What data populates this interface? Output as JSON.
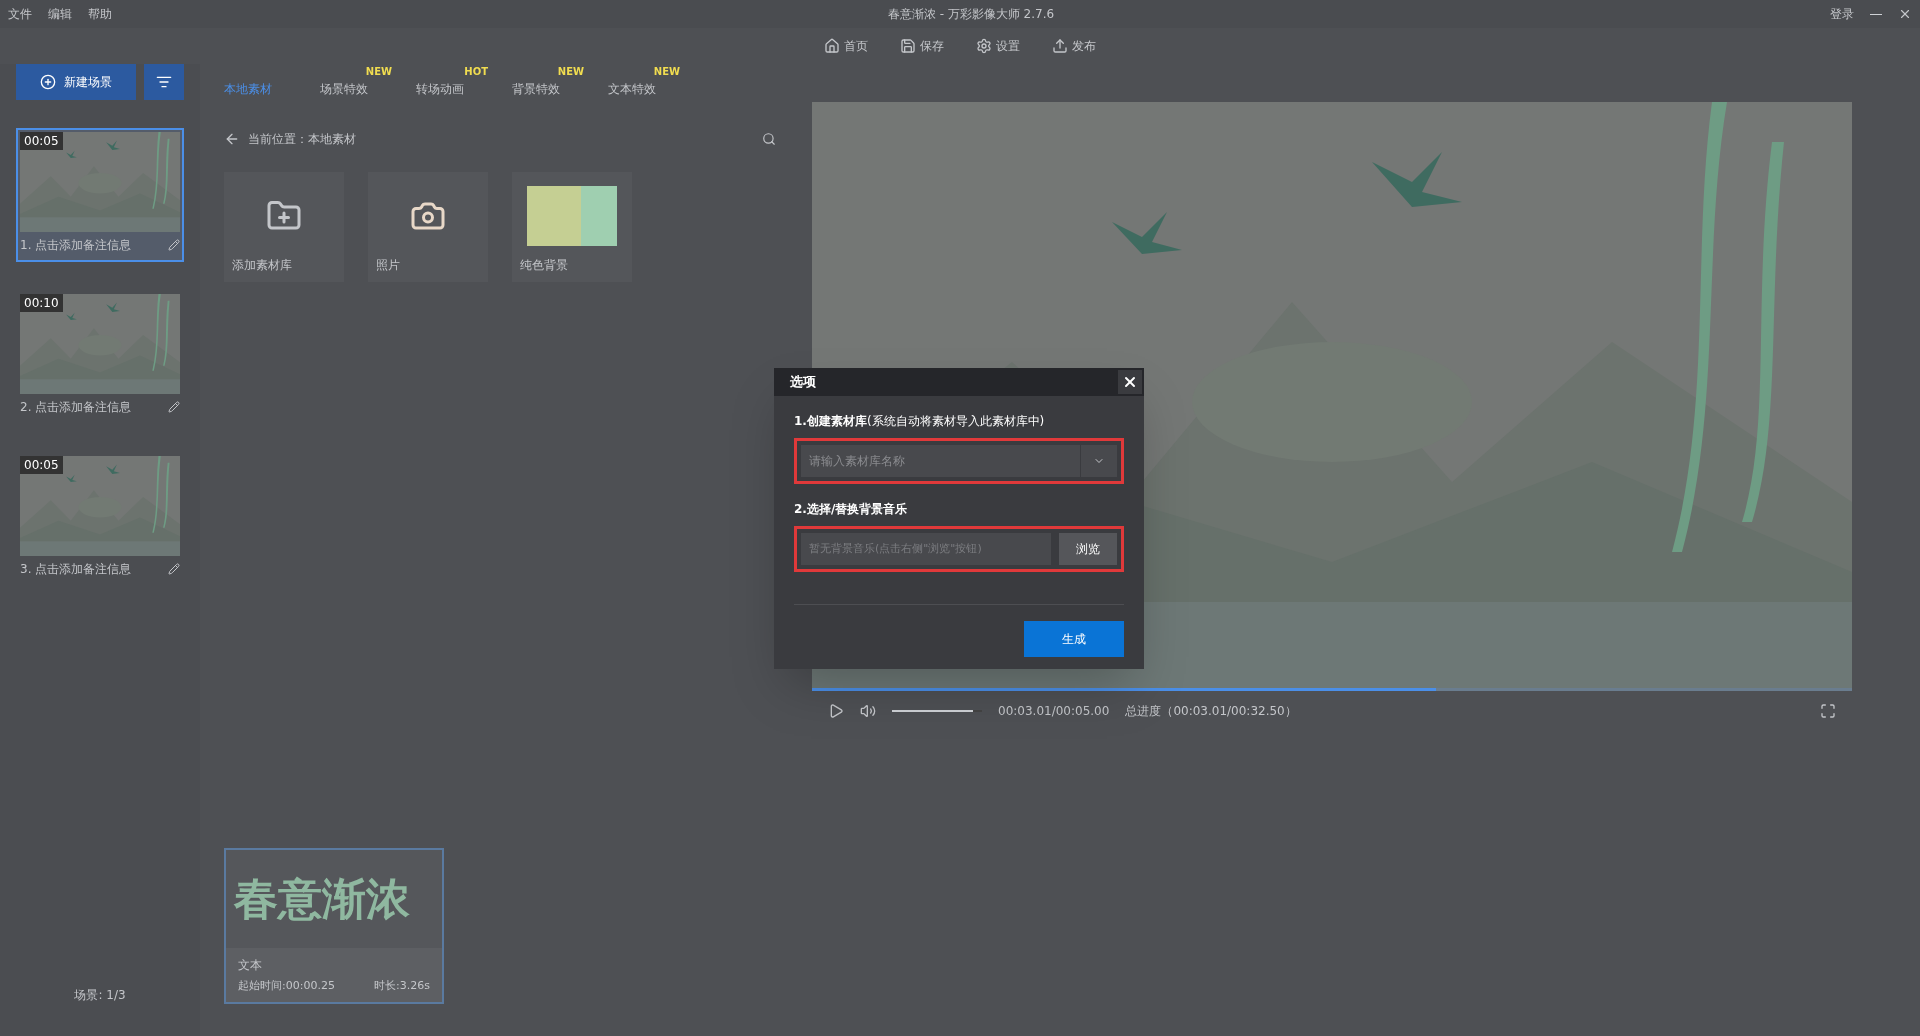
{
  "window": {
    "title": "春意渐浓 - 万彩影像大师 2.7.6",
    "menu": [
      "文件",
      "编辑",
      "帮助"
    ],
    "login": "登录"
  },
  "toolbar": [
    "首页",
    "保存",
    "设置",
    "发布"
  ],
  "left_panel": {
    "new_scene": "新建场景",
    "scenes": [
      {
        "time": "00:05",
        "caption": "1. 点击添加备注信息",
        "selected": true
      },
      {
        "time": "00:10",
        "caption": "2. 点击添加备注信息",
        "selected": false
      },
      {
        "time": "00:05",
        "caption": "3. 点击添加备注信息",
        "selected": false
      }
    ],
    "pager": "场景: 1/3"
  },
  "material_tabs": [
    {
      "label": "本地素材",
      "selected": true
    },
    {
      "label": "场景特效",
      "badge": "NEW",
      "selected": false
    },
    {
      "label": "转场动画",
      "badge": "HOT",
      "selected": false
    },
    {
      "label": "背景特效",
      "badge": "NEW",
      "selected": false
    },
    {
      "label": "文本特效",
      "badge": "NEW",
      "selected": false
    }
  ],
  "breadcrumb": "当前位置：本地素材",
  "material_cards": [
    {
      "kind": "add",
      "label": "添加素材库"
    },
    {
      "kind": "photos",
      "label": "照片"
    },
    {
      "kind": "colors",
      "label": "纯色背景"
    }
  ],
  "player": {
    "time": "00:03.01/00:05.00",
    "total": "总进度（00:03.01/00:32.50）",
    "progress": {
      "level": 0.6
    },
    "volume": {
      "level": 0.9
    }
  },
  "timeline_clip": {
    "preview": "春意渐浓",
    "type": "文本",
    "start": "起始时间:00:00.25",
    "duration": "时长:3.26s"
  },
  "dialog": {
    "title": "选项",
    "sections": [
      {
        "label": "**1.创建素材库**(系统自动将素材导入此素材库中)",
        "placeholder": "请输入素材库名称",
        "kind": "combo",
        "highlighted": true
      },
      {
        "label": "**2.选择/替换背景音乐**",
        "placeholder": "暂无背景音乐(点击右侧\"浏览\"按钮)",
        "kind": "browse",
        "button": "浏览",
        "highlighted": true
      }
    ],
    "primary": "生成"
  }
}
